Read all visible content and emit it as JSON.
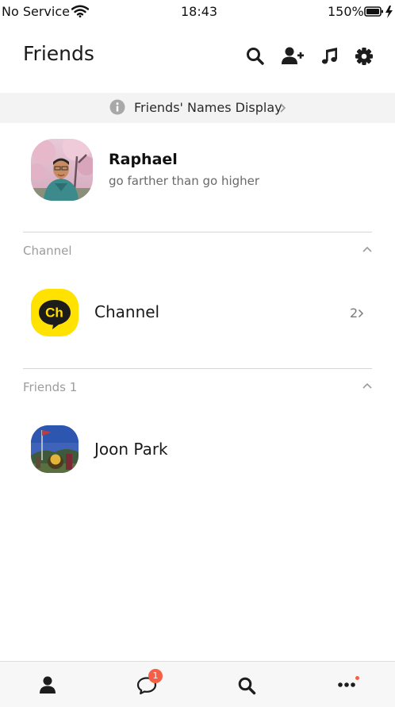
{
  "status_bar": {
    "carrier": "No Service",
    "time": "18:43",
    "battery": "150%"
  },
  "header": {
    "title": "Friends",
    "icons": [
      "search-icon",
      "add-friend-icon",
      "music-icon",
      "gear-icon"
    ]
  },
  "banner": {
    "text": "Friends' Names Display",
    "icon": "info-icon"
  },
  "profile": {
    "name": "Raphael",
    "status": "go farther than go higher"
  },
  "channel_section": {
    "label": "Channel",
    "item_name": "Channel",
    "logo_text": "Ch",
    "count": "2"
  },
  "friends_section": {
    "label": "Friends 1",
    "friends": [
      {
        "name": "Joon Park"
      }
    ]
  },
  "tab_bar": {
    "chats_badge": "1",
    "tabs": [
      "person-icon",
      "chat-bubble-icon",
      "search-icon",
      "more-icon"
    ]
  },
  "colors": {
    "channel_yellow": "#FFE200",
    "badge_red": "#F65F46",
    "banner_bg": "#F3F3F3"
  }
}
